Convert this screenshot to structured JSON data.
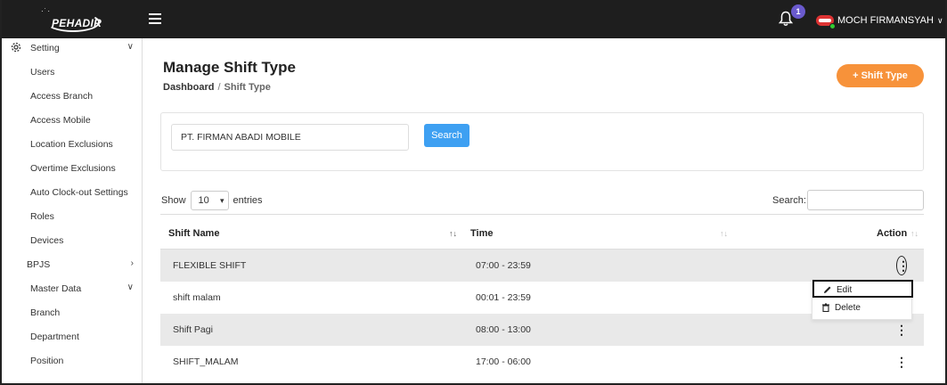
{
  "app": {
    "logo_text": "PEHADIR"
  },
  "header": {
    "notification_count": "1",
    "user_name": "MOCH FIRMANSYAH"
  },
  "sidebar": {
    "items": [
      {
        "label": "Setting",
        "icon": "gear-icon",
        "chevron": "down"
      },
      {
        "label": "Users"
      },
      {
        "label": "Access Branch"
      },
      {
        "label": "Access Mobile"
      },
      {
        "label": "Location Exclusions"
      },
      {
        "label": "Overtime Exclusions"
      },
      {
        "label": "Auto Clock-out Settings"
      },
      {
        "label": "Roles"
      },
      {
        "label": "Devices"
      },
      {
        "label": "BPJS",
        "chevron": "right"
      },
      {
        "label": "Master Data",
        "chevron": "down"
      },
      {
        "label": "Branch"
      },
      {
        "label": "Department"
      },
      {
        "label": "Position"
      }
    ]
  },
  "page": {
    "title": "Manage Shift Type",
    "breadcrumb": {
      "home": "Dashboard",
      "separator": "/",
      "current": "Shift Type"
    },
    "add_button": "Shift Type"
  },
  "filter": {
    "company_value": "PT. FIRMAN ABADI MOBILE",
    "search_button": "Search"
  },
  "table_controls": {
    "show_label": "Show",
    "entries_value": "10",
    "entries_label": "entries",
    "search_label": "Search:"
  },
  "table": {
    "columns": [
      "Shift Name",
      "Time",
      "Action"
    ],
    "rows": [
      {
        "name": "FLEXIBLE SHIFT",
        "time": "07:00 - 23:59"
      },
      {
        "name": "shift malam",
        "time": "00:01 - 23:59"
      },
      {
        "name": "Shift Pagi",
        "time": "08:00 - 13:00"
      },
      {
        "name": "SHIFT_MALAM",
        "time": "17:00 - 06:00"
      }
    ]
  },
  "action_menu": {
    "items": [
      {
        "label": "Edit",
        "icon": "pencil-icon"
      },
      {
        "label": "Delete",
        "icon": "trash-icon"
      }
    ]
  },
  "colors": {
    "topbar": "#1e1e1e",
    "accent_orange": "#f7923a",
    "search_blue": "#3ea0f2",
    "badge_purple": "#6a5acd",
    "row_stripe": "#e9e9e9"
  }
}
